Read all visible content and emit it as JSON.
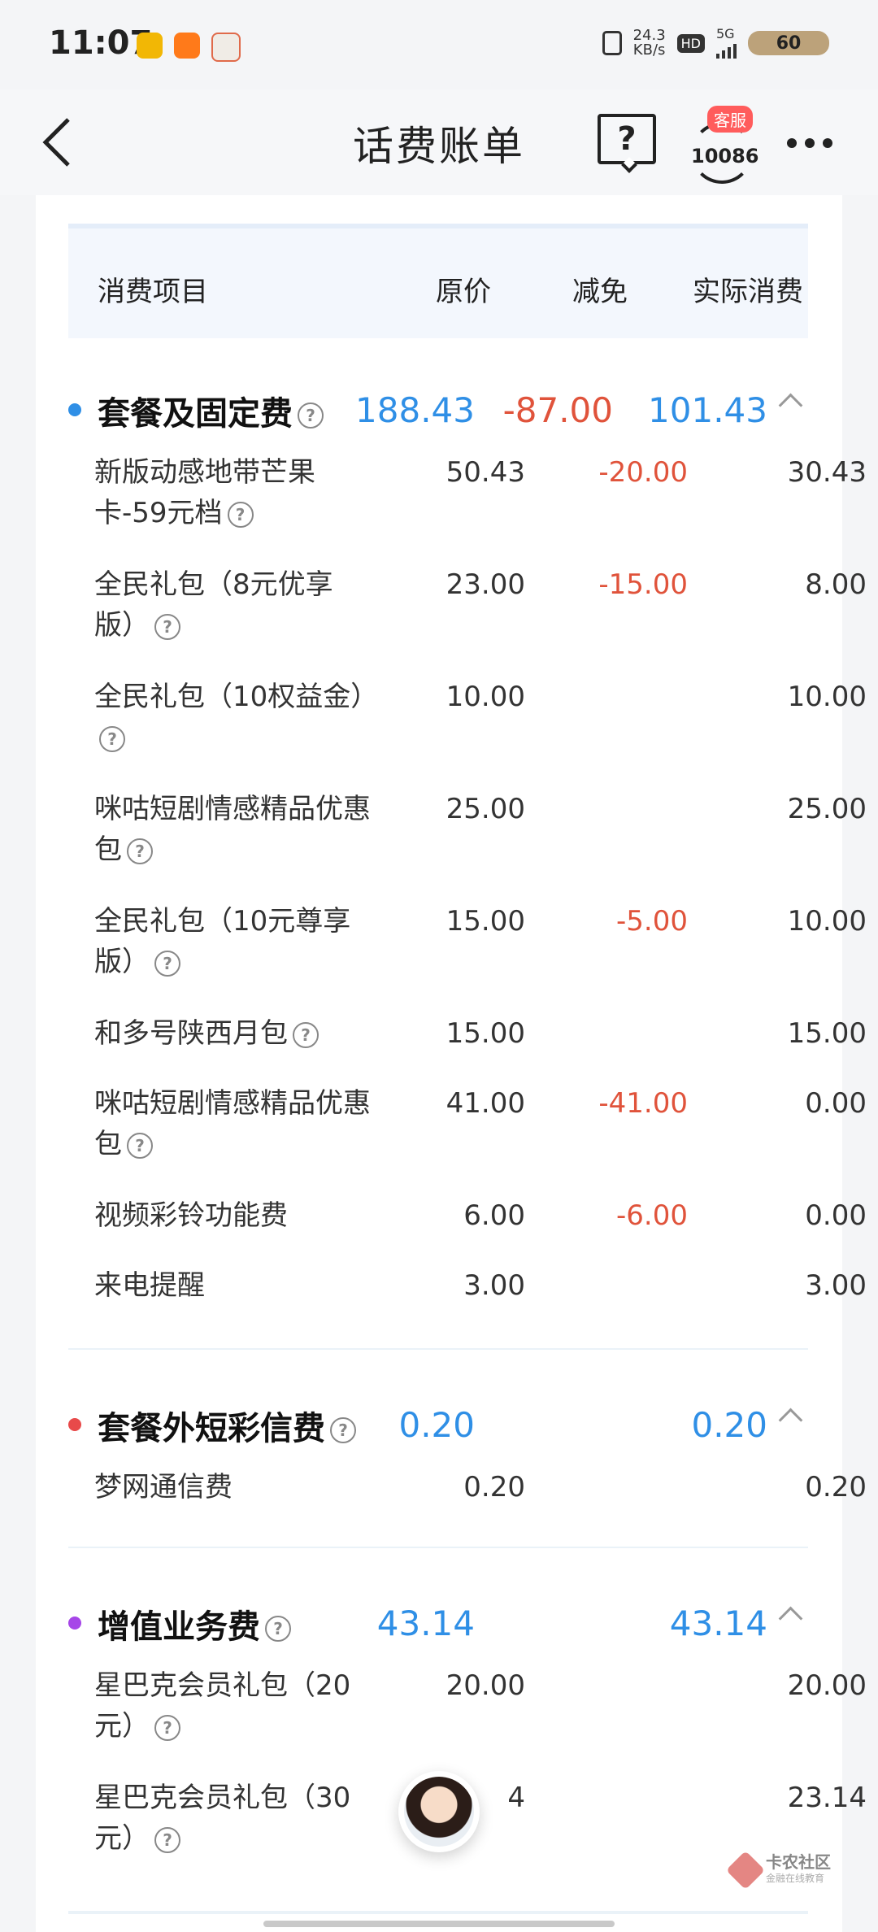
{
  "status_bar": {
    "time": "11:07",
    "speed_value": "24.3",
    "speed_unit": "KB/s",
    "hd": "HD",
    "network": "5G",
    "battery": "60"
  },
  "header": {
    "title": "话费账单",
    "service_badge": "客服",
    "service_number": "10086",
    "help_glyph": "?"
  },
  "table": {
    "headers": [
      "消费项目",
      "原价",
      "减免",
      "实际消费"
    ]
  },
  "sections": [
    {
      "title": "套餐及固定费",
      "color": "#2f8fe6",
      "original": "188.43",
      "discount": "-87.00",
      "actual": "101.43",
      "items": [
        {
          "name": "新版动感地带芒果卡-59元档",
          "original": "50.43",
          "discount": "-20.00",
          "actual": "30.43"
        },
        {
          "name": "全民礼包（8元优享版）",
          "original": "23.00",
          "discount": "-15.00",
          "actual": "8.00"
        },
        {
          "name": "全民礼包（10权益金）",
          "original": "10.00",
          "discount": "",
          "actual": "10.00"
        },
        {
          "name": "咪咕短剧情感精品优惠包",
          "original": "25.00",
          "discount": "",
          "actual": "25.00"
        },
        {
          "name": "全民礼包（10元尊享版）",
          "original": "15.00",
          "discount": "-5.00",
          "actual": "10.00"
        },
        {
          "name": "和多号陕西月包",
          "original": "15.00",
          "discount": "",
          "actual": "15.00"
        },
        {
          "name": "咪咕短剧情感精品优惠包",
          "original": "41.00",
          "discount": "-41.00",
          "actual": "0.00"
        },
        {
          "name": "视频彩铃功能费",
          "original": "6.00",
          "discount": "-6.00",
          "actual": "0.00"
        },
        {
          "name": "来电提醒",
          "original": "3.00",
          "discount": "",
          "actual": "3.00"
        }
      ]
    },
    {
      "title": "套餐外短彩信费",
      "color": "#e84a4a",
      "original": "0.20",
      "discount": "",
      "actual": "0.20",
      "items": [
        {
          "name": "梦网通信费",
          "original": "0.20",
          "discount": "",
          "actual": "0.20"
        }
      ]
    },
    {
      "title": "增值业务费",
      "color": "#a646e8",
      "original": "43.14",
      "discount": "",
      "actual": "43.14",
      "items": [
        {
          "name": "星巴克会员礼包（20元）",
          "original": "20.00",
          "discount": "",
          "actual": "20.00"
        },
        {
          "name": "星巴克会员礼包（30元）",
          "original": "4",
          "discount": "",
          "actual": "23.14"
        }
      ]
    }
  ],
  "watermark": {
    "title": "卡农社区",
    "subtitle": "金融在线教育"
  }
}
